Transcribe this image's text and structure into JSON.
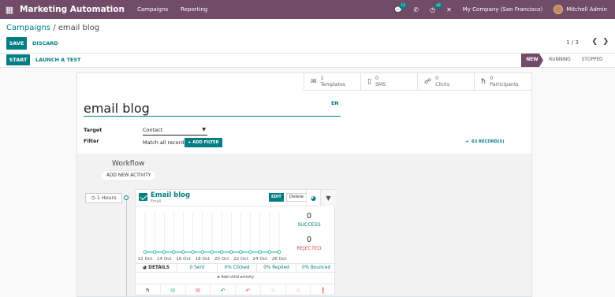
{
  "navbar": {
    "app_title": "Marketing Automation",
    "menu": [
      "Campaigns",
      "Reporting"
    ],
    "chat_badge": "12",
    "activity_badge": "42",
    "company": "My Company (San Francisco)",
    "user": "Mitchell Admin"
  },
  "breadcrumb": {
    "parent": "Campaigns",
    "separator": " / ",
    "current": "email blog"
  },
  "buttons": {
    "save": "SAVE",
    "discard": "DISCARD",
    "start": "START",
    "launch_test": "LAUNCH A TEST"
  },
  "pager": {
    "value": "1 / 3"
  },
  "stages": [
    "NEW",
    "RUNNING",
    "STOPPED"
  ],
  "active_stage": "NEW",
  "smart_buttons": [
    {
      "count": "1",
      "label": "Templates",
      "icon": "envelope-icon"
    },
    {
      "count": "0",
      "label": "SMS",
      "icon": "mobile-icon"
    },
    {
      "count": "0",
      "label": "Clicks",
      "icon": "link-icon"
    },
    {
      "count": "0",
      "label": "Participants",
      "icon": "user-icon"
    }
  ],
  "form": {
    "name": "email blog",
    "lang": "EN",
    "target_label": "Target",
    "target_value": "Contact",
    "filter_label": "Filter",
    "filter_text": "Match all records",
    "add_filter": "ADD FILTER",
    "records": "63 RECORD(S)"
  },
  "workflow": {
    "title": "Workflow",
    "add_activity": "ADD NEW ACTIVITY",
    "trigger": "1 Hours",
    "activity": {
      "title": "Email blog",
      "type": "Email",
      "edit": "EDIT",
      "delete": "Delete",
      "success_count": "0",
      "success_label": "SUCCESS",
      "rejected_count": "0",
      "rejected_label": "REJECTED",
      "details": "DETAILS",
      "sent": "0 Sent",
      "clicked": "0% Clicked",
      "replied": "0% Replied",
      "bounced": "0% Bounced",
      "add_child": "Add child activity"
    }
  },
  "chart_data": {
    "type": "line",
    "x": [
      "12 Oct",
      "13 Oct",
      "14 Oct",
      "15 Oct",
      "16 Oct",
      "17 Oct",
      "18 Oct",
      "19 Oct",
      "20 Oct",
      "21 Oct",
      "22 Oct",
      "23 Oct",
      "24 Oct",
      "25 Oct",
      "26 Oct"
    ],
    "tick_labels": [
      "12 Oct",
      "14 Oct",
      "16 Oct",
      "18 Oct",
      "20 Oct",
      "22 Oct",
      "24 Oct",
      "26 Oct"
    ],
    "series": [
      {
        "values": [
          0,
          0,
          0,
          0,
          0,
          0,
          0,
          0,
          0,
          0,
          0,
          0,
          0,
          0,
          0
        ],
        "color": "#21b799"
      }
    ],
    "grid": true
  },
  "colors": {
    "brand": "#714B67",
    "accent": "#017e84",
    "success": "#017e84",
    "danger": "#d44c59"
  }
}
